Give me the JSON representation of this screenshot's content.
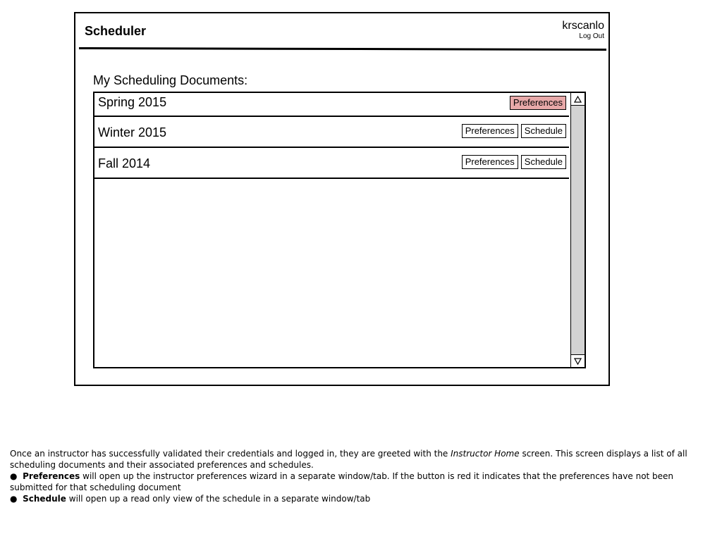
{
  "app": {
    "title": "Scheduler",
    "username": "krscanlo",
    "logout_label": "Log Out"
  },
  "main": {
    "section_label": "My Scheduling Documents:",
    "documents": [
      {
        "name": "Spring 2015",
        "preferences_label": "Preferences",
        "preferences_submitted": false,
        "schedule_label": null
      },
      {
        "name": "Winter 2015",
        "preferences_label": "Preferences",
        "preferences_submitted": true,
        "schedule_label": "Schedule"
      },
      {
        "name": "Fall 2014",
        "preferences_label": "Preferences",
        "preferences_submitted": true,
        "schedule_label": "Schedule"
      }
    ],
    "scroll_up_icon": "triangle-up-icon",
    "scroll_down_icon": "triangle-down-icon"
  },
  "caption": {
    "intro_1": "Once an instructor has successfully validated their credentials and logged in, they are greeted with the ",
    "intro_em": "Instructor Home",
    "intro_2": " screen. This screen displays a list of all scheduling documents and their associated preferences and schedules.",
    "bullet_1_term": "Preferences",
    "bullet_1_text": " will open up the instructor preferences wizard in a separate window/tab. If the button is red it indicates that the preferences have not been submitted for that scheduling document",
    "bullet_2_term": "Schedule",
    "bullet_2_text": " will open up a read only view of the schedule in a separate window/tab"
  },
  "colors": {
    "pending_button": "#e8a9a9",
    "scrollbar_track": "#d3d3d3"
  }
}
